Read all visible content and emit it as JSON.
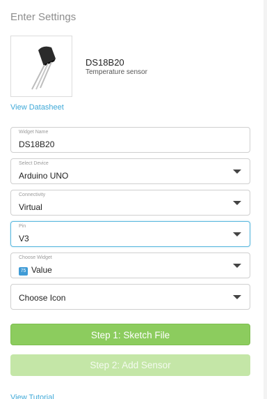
{
  "page": {
    "title": "Enter Settings"
  },
  "sensor": {
    "name": "DS18B20",
    "description": "Temperature sensor",
    "datasheet_link": "View Datasheet"
  },
  "form": {
    "widget_name": {
      "label": "Widget Name",
      "value": "DS18B20"
    },
    "device": {
      "label": "Select Device",
      "value": "Arduino UNO"
    },
    "connectivity": {
      "label": "Connectivity",
      "value": "Virtual"
    },
    "pin": {
      "label": "Pin",
      "value": "V3"
    },
    "widget": {
      "label": "Choose Widget",
      "badge": "75",
      "value": "Value"
    },
    "icon": {
      "value": "Choose Icon"
    }
  },
  "actions": {
    "step1": "Step 1: Sketch File",
    "step2": "Step 2: Add Sensor"
  },
  "footer": {
    "tutorial_link": "View Tutorial"
  },
  "colors": {
    "accent_blue": "#3fa9d8",
    "primary_green": "#8ccc5e",
    "disabled_green": "#c4e6a7"
  }
}
